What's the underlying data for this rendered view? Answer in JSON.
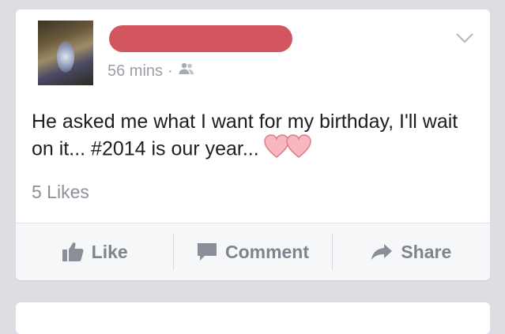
{
  "post": {
    "time": "56 mins",
    "meta_separator": "·",
    "audience_icon": "friends-icon",
    "text": "He asked me what I want for my birthday, I'll wait on it... #2014 is our year...",
    "emoji": "two-hearts",
    "likes": "5 Likes"
  },
  "actions": {
    "like_label": "Like",
    "comment_label": "Comment",
    "share_label": "Share"
  },
  "colors": {
    "background": "#dcdee3",
    "card": "#ffffff",
    "redaction": "#d35560",
    "action_text": "#7f848c",
    "heart": "#f6b7c0"
  }
}
